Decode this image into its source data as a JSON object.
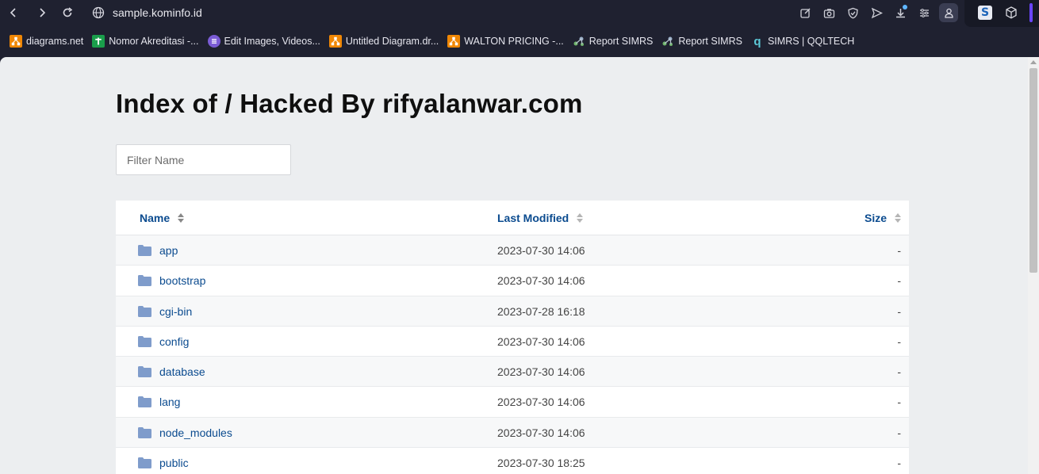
{
  "browser": {
    "url": "sample.kominfo.id"
  },
  "bookmarks": [
    {
      "label": "diagrams.net",
      "icon": "drawio-icon"
    },
    {
      "label": "Nomor Akreditasi -...",
      "icon": "cross-icon"
    },
    {
      "label": "Edit Images, Videos...",
      "icon": "editor-icon"
    },
    {
      "label": "Untitled Diagram.dr...",
      "icon": "drawio-icon"
    },
    {
      "label": "WALTON PRICING -...",
      "icon": "drawio-icon"
    },
    {
      "label": "Report SIMRS",
      "icon": "report-icon"
    },
    {
      "label": "Report SIMRS",
      "icon": "report-icon"
    },
    {
      "label": "SIMRS | QQLTECH",
      "icon": "qqltech-icon"
    }
  ],
  "page": {
    "title": "Index of / Hacked By rifyalanwar.com",
    "filter_placeholder": "Filter Name",
    "columns": {
      "name": "Name",
      "modified": "Last Modified",
      "size": "Size"
    },
    "rows": [
      {
        "name": "app",
        "modified": "2023-07-30 14:06",
        "size": "-"
      },
      {
        "name": "bootstrap",
        "modified": "2023-07-30 14:06",
        "size": "-"
      },
      {
        "name": "cgi-bin",
        "modified": "2023-07-28 16:18",
        "size": "-"
      },
      {
        "name": "config",
        "modified": "2023-07-30 14:06",
        "size": "-"
      },
      {
        "name": "database",
        "modified": "2023-07-30 14:06",
        "size": "-"
      },
      {
        "name": "lang",
        "modified": "2023-07-30 14:06",
        "size": "-"
      },
      {
        "name": "node_modules",
        "modified": "2023-07-30 14:06",
        "size": "-"
      },
      {
        "name": "public",
        "modified": "2023-07-30 18:25",
        "size": "-"
      }
    ]
  },
  "colors": {
    "link": "#0b4b8f",
    "folder": "#7f9ccb",
    "page_bg": "#eceef0"
  }
}
